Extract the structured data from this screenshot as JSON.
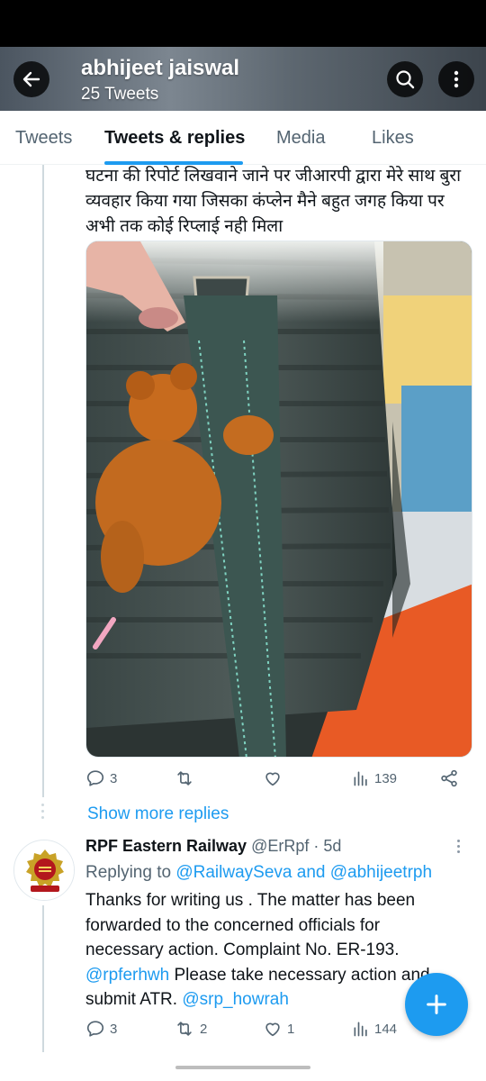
{
  "header": {
    "title": "abhijeet jaiswal",
    "subtitle": "25 Tweets",
    "icons": {
      "back": "arrow-left-icon",
      "search": "search-icon",
      "more": "more-vertical-icon"
    }
  },
  "tabs": [
    {
      "label": "Tweets",
      "active": false
    },
    {
      "label": "Tweets & replies",
      "active": true
    },
    {
      "label": "Media",
      "active": false
    },
    {
      "label": "Likes",
      "active": false
    }
  ],
  "tweet": {
    "text_lines": [
      "घटना की रिपोर्ट लिखवाने जाने पर जीआरपी द्वारा मेरे साथ बुरा",
      "व्यवहार किया गया जिसका कंप्लेन मैने बहुत जगह किया पर",
      "अभी तक कोई रिप्लाई नही मिला"
    ],
    "media": {
      "description_icon": "photo",
      "content": "bag-with-teddy-bear-photo"
    },
    "stats": {
      "replies": "3",
      "retweets": "",
      "likes": "",
      "views": "139"
    }
  },
  "show_more": "Show more replies",
  "reply": {
    "name": "RPF Eastern Railway",
    "handle": "@ErRpf",
    "separator": " · ",
    "time": "5d",
    "replying_prefix": "Replying to ",
    "replying_user1": "@RailwaySeva",
    "replying_and": " and ",
    "replying_user2": "@abhijeetrph",
    "body_line1": "Thanks  for writing us . The  matter  has been",
    "body_line2": "forwarded  to the  concerned  officials  for",
    "body_line3": "necessary action. Complaint No. ER-193.",
    "body_mention1": "@rpferhwh",
    "body_line4_rest": " Please take necessary  action and",
    "body_line5_start": "submit ATR. ",
    "body_mention2": "@srp_howrah",
    "stats": {
      "replies": "3",
      "retweets": "2",
      "likes": "1",
      "views": "144"
    }
  },
  "colors": {
    "accent": "#1d9bf0",
    "text": "#0f1419",
    "muted": "#536471"
  }
}
